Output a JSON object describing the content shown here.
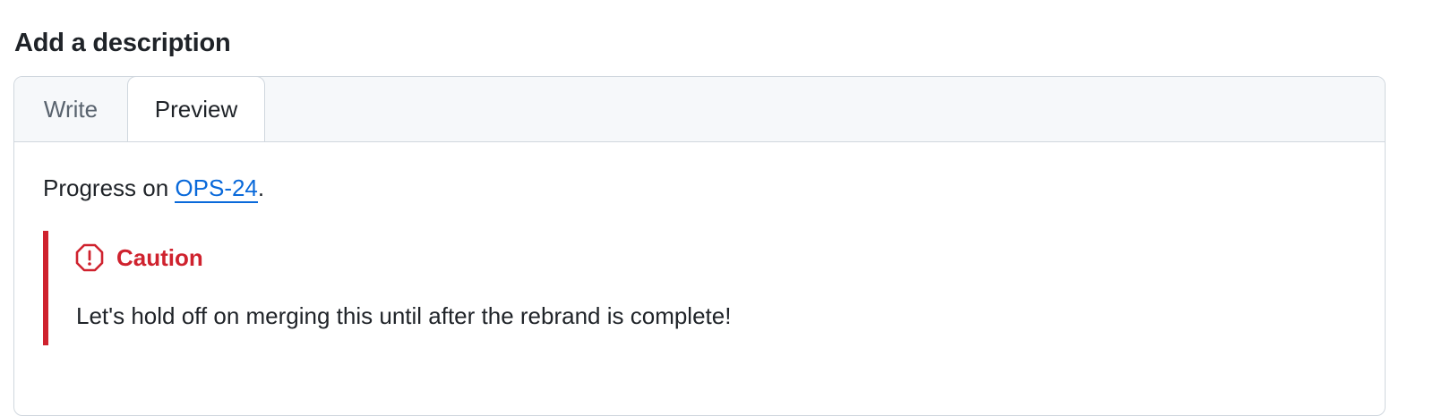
{
  "section": {
    "heading": "Add a description"
  },
  "tabs": {
    "write_label": "Write",
    "preview_label": "Preview",
    "active": "Preview"
  },
  "preview": {
    "intro_text": "Progress on ",
    "link_text": "OPS-24",
    "intro_suffix": ".",
    "alert": {
      "type": "caution",
      "icon": "stop-octagon-icon",
      "title": "Caution",
      "text": "Let's hold off on merging this until after the rebrand is complete!",
      "color": "#cf222e"
    }
  },
  "colors": {
    "link": "#0969da",
    "border": "#d0d7de",
    "tabbar_bg": "#f6f8fa",
    "text": "#1f2328",
    "muted_text": "#59636e"
  }
}
